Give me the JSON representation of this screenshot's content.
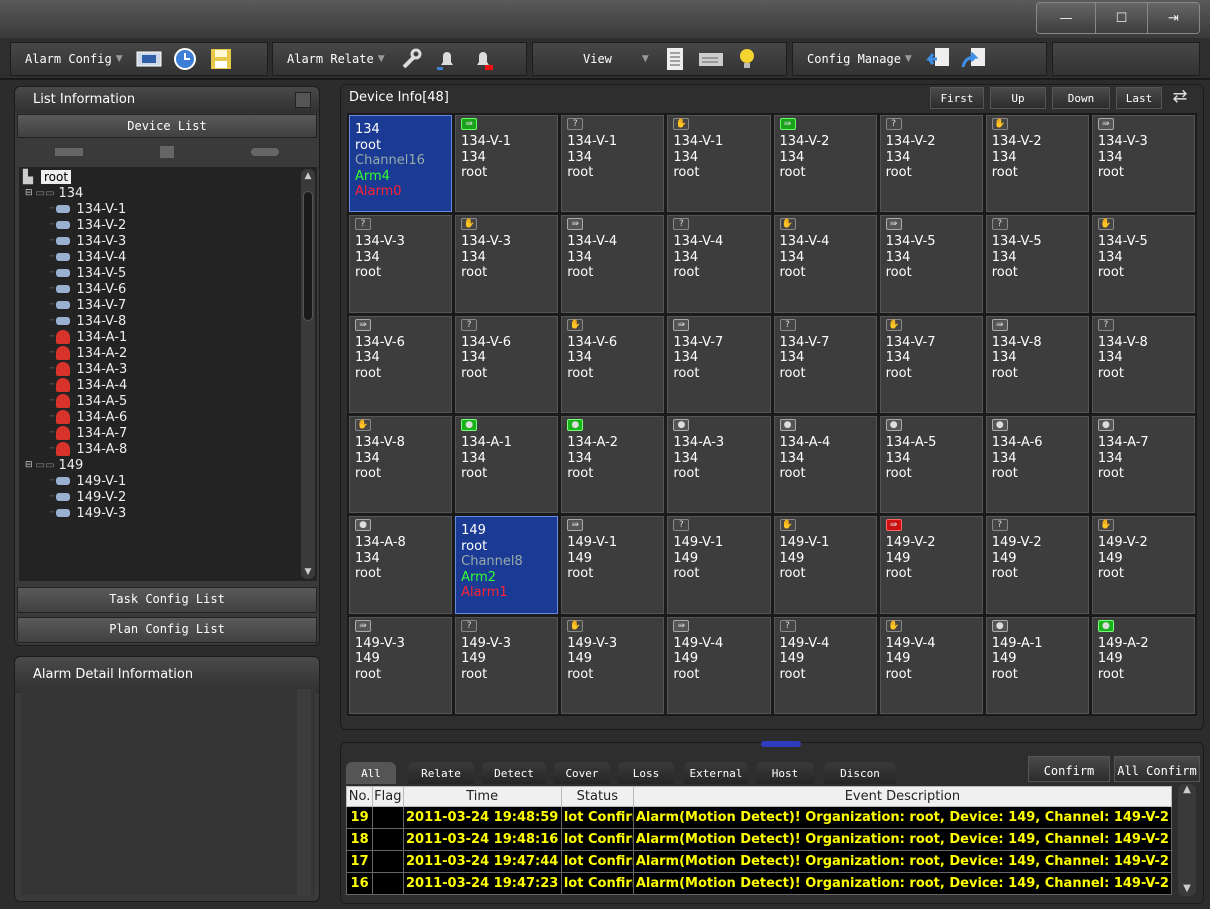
{
  "window": {
    "min": "—",
    "restore": "☐",
    "close": "⇥"
  },
  "toolbar": {
    "alarm_config": "Alarm Config",
    "alarm_relate": "Alarm Relate",
    "view": "View",
    "config_manage": "Config Manage"
  },
  "list_panel": {
    "title": "List Information",
    "device_list": "Device List",
    "task_config_list": "Task Config List",
    "plan_config_list": "Plan Config List"
  },
  "tree": {
    "root": "root",
    "groups": [
      {
        "name": "134",
        "children": [
          "134-V-1",
          "134-V-2",
          "134-V-3",
          "134-V-4",
          "134-V-5",
          "134-V-6",
          "134-V-7",
          "134-V-8",
          "134-A-1",
          "134-A-2",
          "134-A-3",
          "134-A-4",
          "134-A-5",
          "134-A-6",
          "134-A-7",
          "134-A-8"
        ]
      },
      {
        "name": "149",
        "children": [
          "149-V-1",
          "149-V-2",
          "149-V-3"
        ]
      }
    ]
  },
  "alarm_detail": {
    "title": "Alarm Detail Information"
  },
  "device_info": {
    "title": "Device Info[48]",
    "first": "First",
    "up": "Up",
    "down": "Down",
    "last": "Last"
  },
  "cells": [
    {
      "type": "selected",
      "line1": "134",
      "line2": "root",
      "line3": "Channel16",
      "line4": "Arm4",
      "line5": "Alarm0"
    },
    {
      "icon": "green",
      "name": "134-V-1",
      "dev": "134",
      "org": "root"
    },
    {
      "icon": "q",
      "name": "134-V-1",
      "dev": "134",
      "org": "root"
    },
    {
      "icon": "h",
      "name": "134-V-1",
      "dev": "134",
      "org": "root"
    },
    {
      "icon": "green",
      "name": "134-V-2",
      "dev": "134",
      "org": "root"
    },
    {
      "icon": "q",
      "name": "134-V-2",
      "dev": "134",
      "org": "root"
    },
    {
      "icon": "h",
      "name": "134-V-2",
      "dev": "134",
      "org": "root"
    },
    {
      "icon": "arrow",
      "name": "134-V-3",
      "dev": "134",
      "org": "root"
    },
    {
      "icon": "q",
      "name": "134-V-3",
      "dev": "134",
      "org": "root"
    },
    {
      "icon": "h",
      "name": "134-V-3",
      "dev": "134",
      "org": "root"
    },
    {
      "icon": "arrow",
      "name": "134-V-4",
      "dev": "134",
      "org": "root"
    },
    {
      "icon": "q",
      "name": "134-V-4",
      "dev": "134",
      "org": "root"
    },
    {
      "icon": "h",
      "name": "134-V-4",
      "dev": "134",
      "org": "root"
    },
    {
      "icon": "arrow",
      "name": "134-V-5",
      "dev": "134",
      "org": "root"
    },
    {
      "icon": "q",
      "name": "134-V-5",
      "dev": "134",
      "org": "root"
    },
    {
      "icon": "h",
      "name": "134-V-5",
      "dev": "134",
      "org": "root"
    },
    {
      "icon": "arrow",
      "name": "134-V-6",
      "dev": "134",
      "org": "root"
    },
    {
      "icon": "q",
      "name": "134-V-6",
      "dev": "134",
      "org": "root"
    },
    {
      "icon": "h",
      "name": "134-V-6",
      "dev": "134",
      "org": "root"
    },
    {
      "icon": "arrow",
      "name": "134-V-7",
      "dev": "134",
      "org": "root"
    },
    {
      "icon": "q",
      "name": "134-V-7",
      "dev": "134",
      "org": "root"
    },
    {
      "icon": "h",
      "name": "134-V-7",
      "dev": "134",
      "org": "root"
    },
    {
      "icon": "arrow",
      "name": "134-V-8",
      "dev": "134",
      "org": "root"
    },
    {
      "icon": "q",
      "name": "134-V-8",
      "dev": "134",
      "org": "root"
    },
    {
      "icon": "h",
      "name": "134-V-8",
      "dev": "134",
      "org": "root"
    },
    {
      "icon": "dotgreen",
      "name": "134-A-1",
      "dev": "134",
      "org": "root"
    },
    {
      "icon": "dotgreen",
      "name": "134-A-2",
      "dev": "134",
      "org": "root"
    },
    {
      "icon": "dot",
      "name": "134-A-3",
      "dev": "134",
      "org": "root"
    },
    {
      "icon": "dot",
      "name": "134-A-4",
      "dev": "134",
      "org": "root"
    },
    {
      "icon": "dot",
      "name": "134-A-5",
      "dev": "134",
      "org": "root"
    },
    {
      "icon": "dot",
      "name": "134-A-6",
      "dev": "134",
      "org": "root"
    },
    {
      "icon": "dot",
      "name": "134-A-7",
      "dev": "134",
      "org": "root"
    },
    {
      "icon": "dot",
      "name": "134-A-8",
      "dev": "134",
      "org": "root"
    },
    {
      "type": "selected",
      "line1": "149",
      "line2": "root",
      "line3": "Channel8",
      "line4": "Arm2",
      "line5": "Alarm1"
    },
    {
      "icon": "arrow",
      "name": "149-V-1",
      "dev": "149",
      "org": "root"
    },
    {
      "icon": "q",
      "name": "149-V-1",
      "dev": "149",
      "org": "root"
    },
    {
      "icon": "h",
      "name": "149-V-1",
      "dev": "149",
      "org": "root"
    },
    {
      "icon": "red",
      "name": "149-V-2",
      "dev": "149",
      "org": "root"
    },
    {
      "icon": "q",
      "name": "149-V-2",
      "dev": "149",
      "org": "root"
    },
    {
      "icon": "h",
      "name": "149-V-2",
      "dev": "149",
      "org": "root"
    },
    {
      "icon": "arrow",
      "name": "149-V-3",
      "dev": "149",
      "org": "root"
    },
    {
      "icon": "q",
      "name": "149-V-3",
      "dev": "149",
      "org": "root"
    },
    {
      "icon": "h",
      "name": "149-V-3",
      "dev": "149",
      "org": "root"
    },
    {
      "icon": "arrow",
      "name": "149-V-4",
      "dev": "149",
      "org": "root"
    },
    {
      "icon": "q",
      "name": "149-V-4",
      "dev": "149",
      "org": "root"
    },
    {
      "icon": "h",
      "name": "149-V-4",
      "dev": "149",
      "org": "root"
    },
    {
      "icon": "dot",
      "name": "149-A-1",
      "dev": "149",
      "org": "root"
    },
    {
      "icon": "dotgreen",
      "name": "149-A-2",
      "dev": "149",
      "org": "root"
    }
  ],
  "event_tabs": [
    "All",
    "Relate",
    "Detect",
    "Cover",
    "Loss",
    "External",
    "Host",
    "Discon"
  ],
  "confirm": "Confirm",
  "all_confirm": "All Confirm",
  "event_columns": [
    "No.",
    "Flag",
    "Time",
    "Status",
    "Event Description"
  ],
  "events": [
    {
      "no": "19",
      "flag": "",
      "time": "2011-03-24 19:48:59",
      "status": "lot Confirm",
      "desc": "Alarm(Motion Detect)! Organization: root, Device: 149, Channel: 149-V-2"
    },
    {
      "no": "18",
      "flag": "",
      "time": "2011-03-24 19:48:16",
      "status": "lot Confirm",
      "desc": "Alarm(Motion Detect)! Organization: root, Device: 149, Channel: 149-V-2"
    },
    {
      "no": "17",
      "flag": "",
      "time": "2011-03-24 19:47:44",
      "status": "lot Confirm",
      "desc": "Alarm(Motion Detect)! Organization: root, Device: 149, Channel: 149-V-2"
    },
    {
      "no": "16",
      "flag": "",
      "time": "2011-03-24 19:47:23",
      "status": "lot Confirm",
      "desc": "Alarm(Motion Detect)! Organization: root, Device: 149, Channel: 149-V-2"
    }
  ]
}
